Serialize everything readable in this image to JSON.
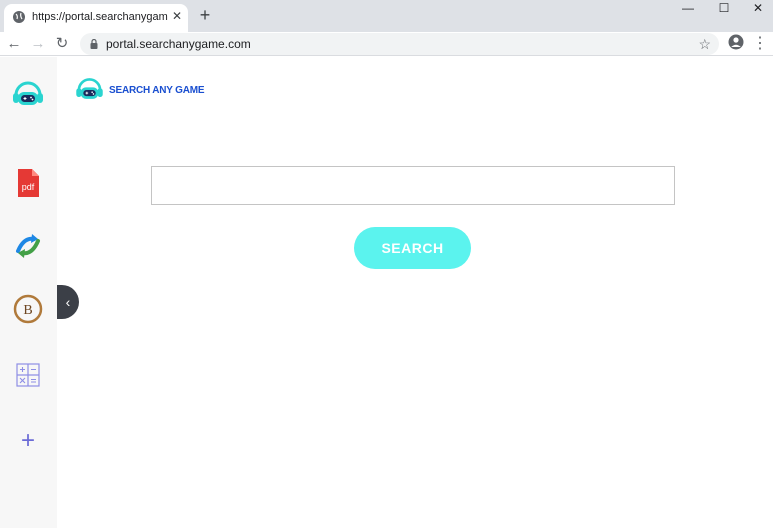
{
  "browser": {
    "tab_title": "https://portal.searchanygame.co",
    "tab_close": "✕",
    "new_tab": "+",
    "url": "portal.searchanygame.com",
    "window_controls": {
      "minimize": "—",
      "maximize": "☐",
      "close": "✕"
    },
    "nav": {
      "back": "←",
      "forward": "→",
      "reload": "↻",
      "star": "☆",
      "menu": "⋮"
    }
  },
  "sidebar": {
    "items": [
      {
        "name": "game-controller-logo-icon"
      },
      {
        "name": "pdf-icon",
        "label": "pdf"
      },
      {
        "name": "converter-arrows-icon"
      },
      {
        "name": "bitcoin-icon",
        "label": "B"
      },
      {
        "name": "calculator-icon"
      },
      {
        "name": "add-icon",
        "label": "+"
      }
    ],
    "collapse_label": "‹"
  },
  "main": {
    "brand_name": "SEARCH ANY GAME",
    "search_value": "",
    "search_button": "SEARCH"
  },
  "colors": {
    "accent": "#5bf3ee",
    "brand": "#1a4fd0",
    "pdf_red": "#e53935"
  }
}
